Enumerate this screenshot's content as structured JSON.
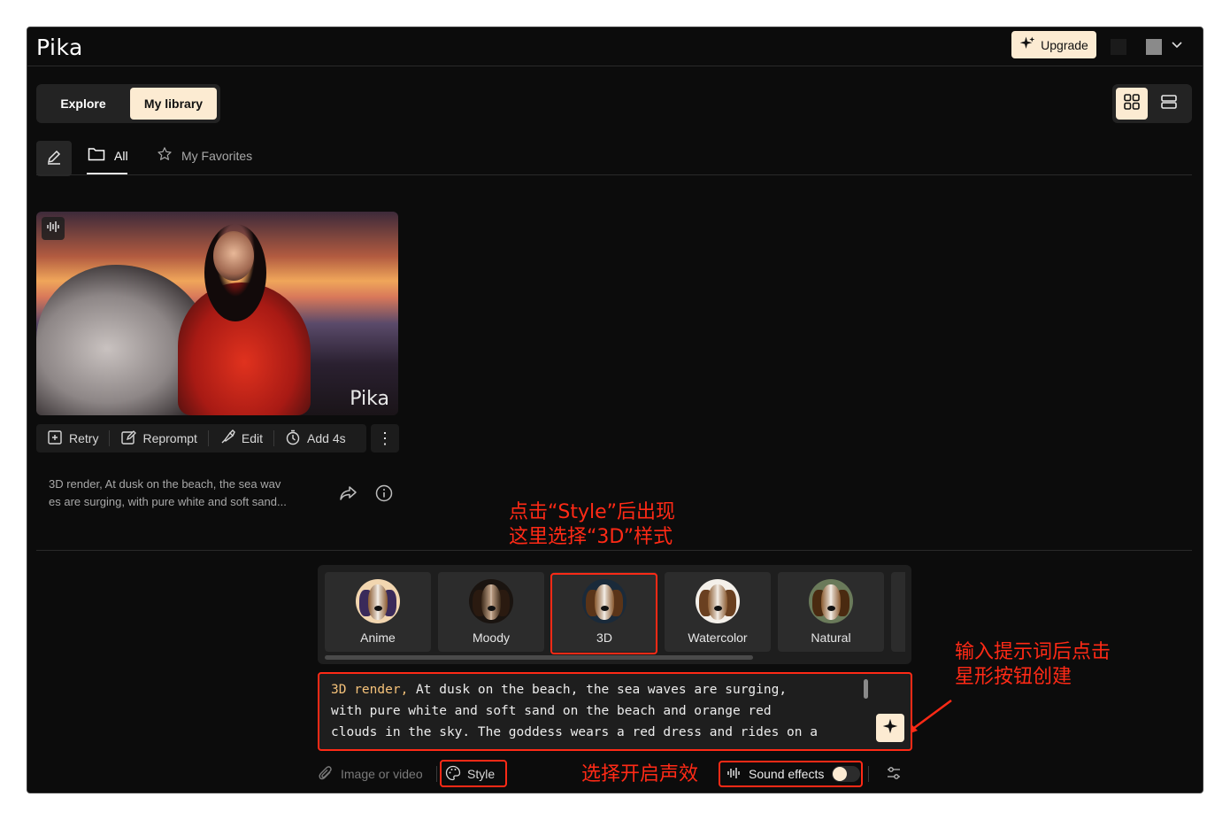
{
  "header": {
    "logo": "Pika",
    "upgrade_label": "Upgrade"
  },
  "view_tabs": {
    "explore": "Explore",
    "my_library": "My library",
    "active": "My library"
  },
  "sub_tabs": {
    "all": "All",
    "favorites": "My Favorites"
  },
  "video": {
    "watermark": "Pika",
    "actions": {
      "retry": "Retry",
      "reprompt": "Reprompt",
      "edit": "Edit",
      "add_time": "Add 4s",
      "more": "⋮"
    },
    "prompt_line1": "3D render, At dusk on the beach, the sea wav",
    "prompt_line2": "es are surging, with pure white and soft sand..."
  },
  "annotations": {
    "style_hint_line1": "点击“Style”后出现",
    "style_hint_line2": "这里选择“3D”样式",
    "create_hint_line1": "输入提示词后点击",
    "create_hint_line2": "星形按钮创建",
    "sound_hint": "选择开启声效",
    "color": "#ff2a16"
  },
  "styles": {
    "selected": "3D",
    "items": [
      {
        "label": "Anime"
      },
      {
        "label": "Moody"
      },
      {
        "label": "3D"
      },
      {
        "label": "Watercolor"
      },
      {
        "label": "Natural"
      }
    ]
  },
  "prompt": {
    "style_tag": "3D render,",
    "line1_rest": " At dusk on the beach, the sea waves are surging,",
    "line2": "with pure white and soft sand on the beach and orange red",
    "line3": "clouds in the sky. The goddess wears a red dress and rides on a"
  },
  "bottom_bar": {
    "attach_label": "Image or video",
    "style_label": "Style",
    "sound_label": "Sound effects",
    "sound_enabled": true
  },
  "colors": {
    "background": "#0c0c0c",
    "accent": "#fcebd2",
    "panel": "#1e1e1e"
  }
}
